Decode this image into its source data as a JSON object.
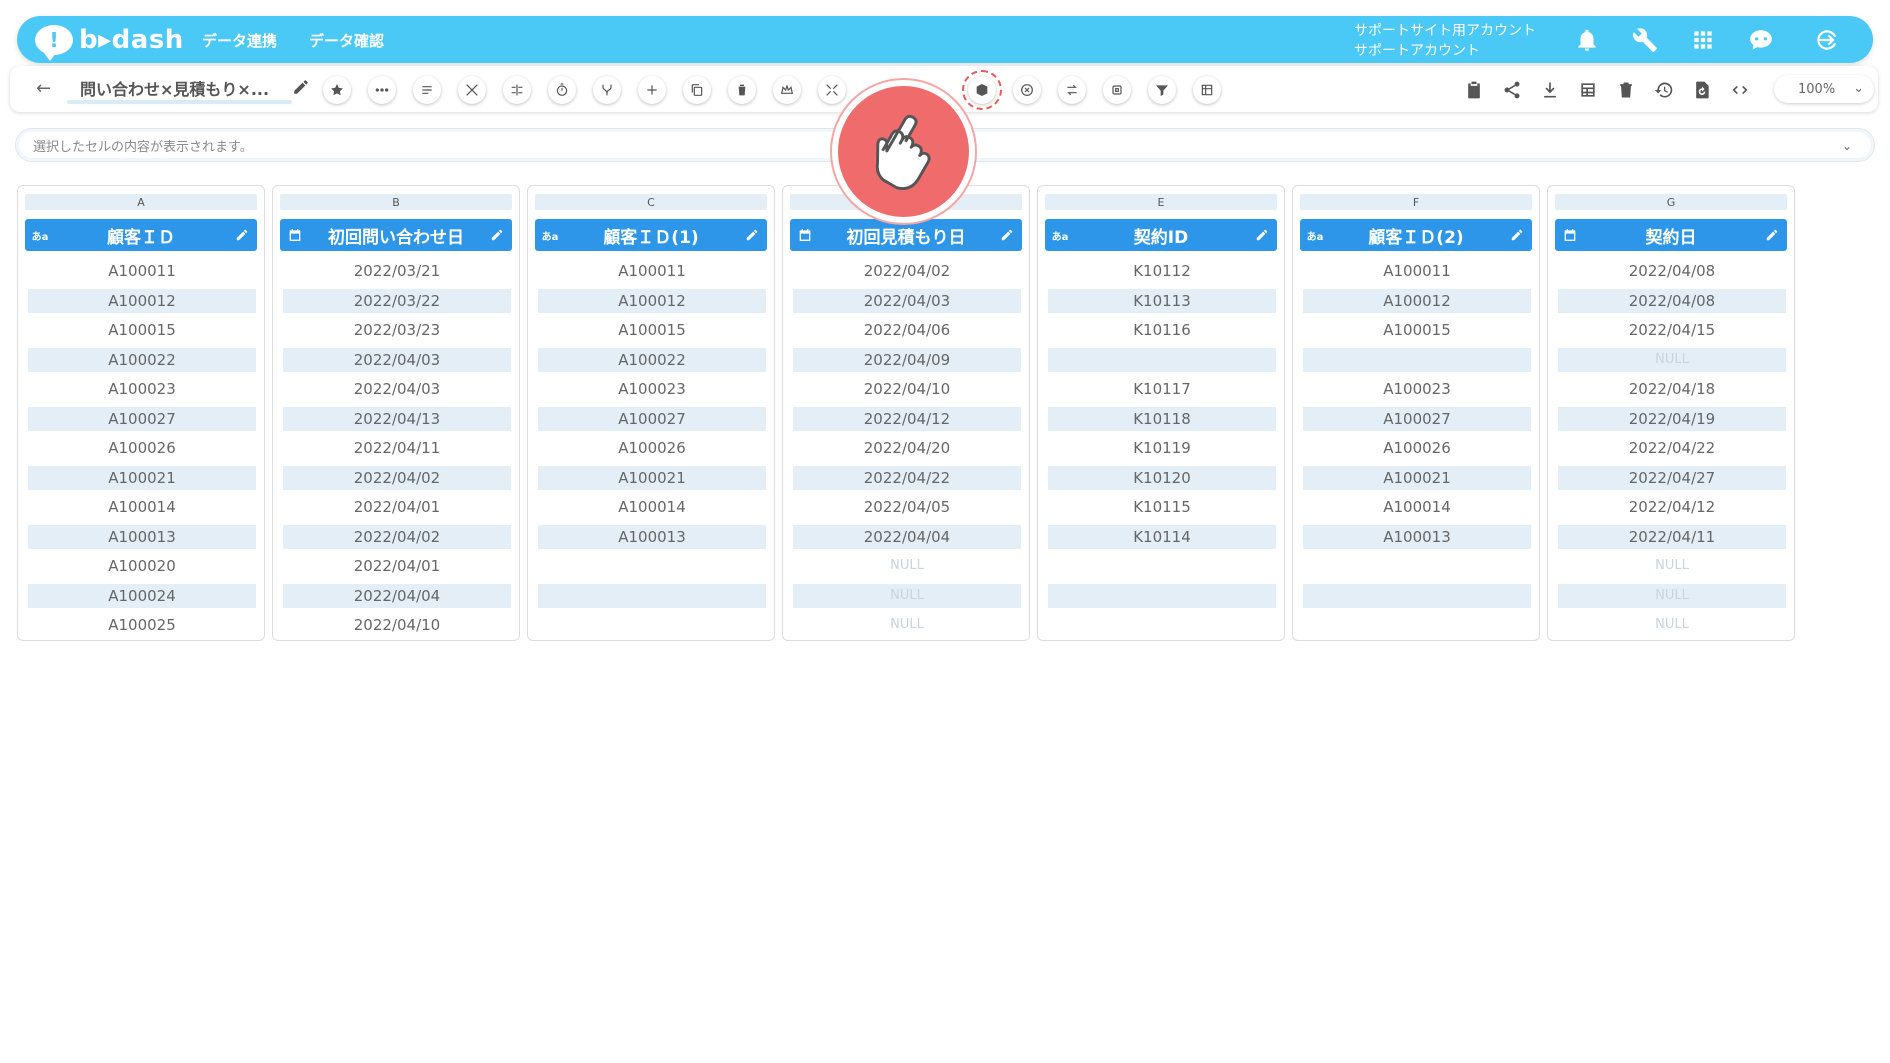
{
  "header": {
    "logo_mark": "!",
    "logo_text": "b▸dash",
    "nav": [
      "データ連携",
      "データ確認"
    ],
    "account_line1": "サポートサイト用アカウント",
    "account_line2": "サポートアカウント",
    "icons": [
      "bell-icon",
      "wrench-icon",
      "apps-grid-icon",
      "chat-bot-icon",
      "logout-icon"
    ]
  },
  "toolbar": {
    "back": "←",
    "report_title": "問い合わせ×見積もり×...",
    "buttons": [
      "star",
      "more",
      "list",
      "tools",
      "expand",
      "timer",
      "merge",
      "add",
      "copy",
      "delete",
      "crown",
      "shrink",
      "blank1",
      "blank2",
      "cube",
      "close-circle",
      "swap",
      "square",
      "filter",
      "grid"
    ],
    "right_icons": [
      "clipboard-icon",
      "share-icon",
      "download-icon",
      "table-icon",
      "trash-icon",
      "history-icon",
      "refresh-doc-icon",
      "code-icon"
    ],
    "zoom": "100%",
    "zoom_chevron": "⌄"
  },
  "cell_bar": {
    "placeholder": "選択したセルの内容が表示されます。",
    "chevron": "⌄"
  },
  "columns": [
    {
      "letter": "A",
      "name": "顧客ＩＤ",
      "type": "text",
      "type_label": "あa",
      "cells": [
        "A100011",
        "A100012",
        "A100015",
        "A100022",
        "A100023",
        "A100027",
        "A100026",
        "A100021",
        "A100014",
        "A100013",
        "A100020",
        "A100024",
        "A100025"
      ]
    },
    {
      "letter": "B",
      "name": "初回問い合わせ日",
      "type": "date",
      "type_label": "",
      "cells": [
        "2022/03/21",
        "2022/03/22",
        "2022/03/23",
        "2022/04/03",
        "2022/04/03",
        "2022/04/13",
        "2022/04/11",
        "2022/04/02",
        "2022/04/01",
        "2022/04/02",
        "2022/04/01",
        "2022/04/04",
        "2022/04/10"
      ]
    },
    {
      "letter": "C",
      "name": "顧客ＩＤ(1)",
      "type": "text",
      "type_label": "あa",
      "cells": [
        "A100011",
        "A100012",
        "A100015",
        "A100022",
        "A100023",
        "A100027",
        "A100026",
        "A100021",
        "A100014",
        "A100013",
        "",
        ""
      ]
    },
    {
      "letter": "",
      "name": "初回見積もり日",
      "type": "date",
      "type_label": "",
      "cells": [
        "2022/04/02",
        "2022/04/03",
        "2022/04/06",
        "2022/04/09",
        "2022/04/10",
        "2022/04/12",
        "2022/04/20",
        "2022/04/22",
        "2022/04/05",
        "2022/04/04",
        "NULL",
        "NULL",
        "NULL"
      ]
    },
    {
      "letter": "E",
      "name": "契約ID",
      "type": "text",
      "type_label": "あa",
      "cells": [
        "K10112",
        "K10113",
        "K10116",
        "",
        "K10117",
        "K10118",
        "K10119",
        "K10120",
        "K10115",
        "K10114",
        "",
        ""
      ]
    },
    {
      "letter": "F",
      "name": "顧客ＩＤ(2)",
      "type": "text",
      "type_label": "あa",
      "cells": [
        "A100011",
        "A100012",
        "A100015",
        "",
        "A100023",
        "A100027",
        "A100026",
        "A100021",
        "A100014",
        "A100013",
        "",
        ""
      ]
    },
    {
      "letter": "G",
      "name": "契約日",
      "type": "date",
      "type_label": "",
      "cells": [
        "2022/04/08",
        "2022/04/08",
        "2022/04/15",
        "NULL",
        "2022/04/18",
        "2022/04/19",
        "2022/04/22",
        "2022/04/27",
        "2022/04/12",
        "2022/04/11",
        "NULL",
        "NULL",
        "NULL"
      ]
    }
  ],
  "colors": {
    "header_bg": "#4ac8f6",
    "column_header_bg": "#2e96e8",
    "row_alt_bg": "#e3eef7",
    "hand_circle": "#f06b6b",
    "active_button_ring": "#e65b5b"
  }
}
